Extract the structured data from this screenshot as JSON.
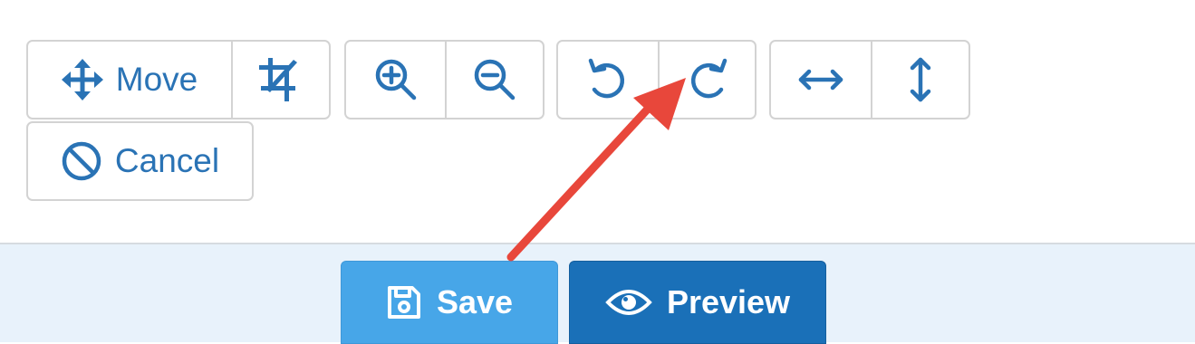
{
  "toolbar": {
    "move_label": "Move",
    "cancel_label": "Cancel",
    "icons": [
      "move-icon",
      "crop-icon",
      "zoom-in-icon",
      "zoom-out-icon",
      "rotate-left-icon",
      "rotate-right-icon",
      "flip-horizontal-icon",
      "flip-vertical-icon",
      "cancel-icon"
    ],
    "icon_color": "#2a73b5",
    "border_color": "#d3d3d3"
  },
  "footer": {
    "save_label": "Save",
    "preview_label": "Preview",
    "save_icon": "floppy-disk-icon",
    "preview_icon": "eye-icon",
    "background": "#e8f2fb",
    "save_color": "#47a6e8",
    "preview_color": "#1a70b8"
  },
  "annotation": {
    "type": "arrow",
    "color": "#e8473b",
    "points_to": "rotate-right-button"
  }
}
